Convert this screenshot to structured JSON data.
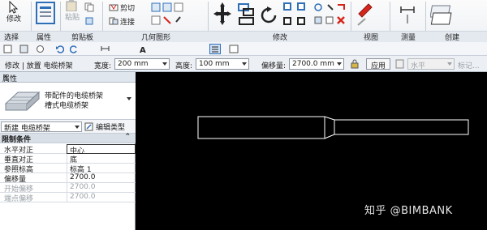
{
  "ribbon": {
    "panels": [
      "选择",
      "属性",
      "剪贴板",
      "几何图形",
      "修改",
      "视图",
      "测量",
      "创建"
    ],
    "modify_label": "修改",
    "paste_label": "粘贴",
    "cut_label": "剪切",
    "join_label": "连接"
  },
  "options_bar": {
    "mode": "修改 | 放置 电缆桥架",
    "width_label": "宽度:",
    "width_value": "200 mm",
    "height_label": "高度:",
    "height_value": "100 mm",
    "offset_label": "偏移量:",
    "offset_value": "2700.0 mm",
    "apply_label": "应用",
    "horizontal_label": "水平",
    "tag_label": "标记..."
  },
  "properties": {
    "title": "属性",
    "close_glyph": "×",
    "type_line1": "带配件的电缆桥架",
    "type_line2": "槽式电缆桥架",
    "instance_dropdown": "新建 电缆桥架",
    "edit_type": "编辑类型",
    "category": "限制条件",
    "collapse_glyph": "⌃",
    "rows": [
      {
        "key": "水平对正",
        "value": "中心"
      },
      {
        "key": "垂直对正",
        "value": "底"
      },
      {
        "key": "参照标高",
        "value": "标高 1"
      },
      {
        "key": "偏移量",
        "value": "2700.0"
      },
      {
        "key": "开始偏移",
        "value": "2700.0"
      },
      {
        "key": "端点偏移",
        "value": "2700.0"
      }
    ]
  },
  "canvas": {
    "watermark": "知乎 @BIMBANK"
  },
  "colors": {
    "canvas_bg": "#000000",
    "sketch_line": "#ffffff",
    "ribbon_bg": "#eef1f5",
    "icon_red": "#d6261c",
    "icon_blue": "#2f6fb8"
  }
}
